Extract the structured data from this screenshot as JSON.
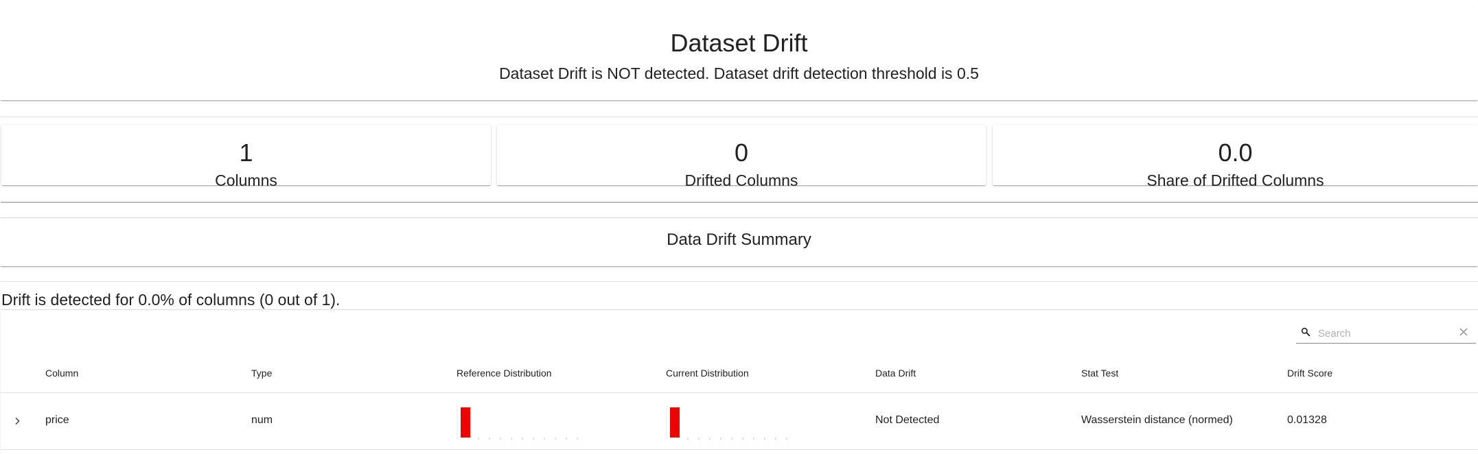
{
  "header": {
    "title": "Dataset Drift",
    "subtitle": "Dataset Drift is NOT detected. Dataset drift detection threshold is 0.5"
  },
  "metrics": [
    {
      "value": "1",
      "label": "Columns"
    },
    {
      "value": "0",
      "label": "Drifted Columns"
    },
    {
      "value": "0.0",
      "label": "Share of Drifted Columns"
    }
  ],
  "summary": {
    "title": "Data Drift Summary",
    "text": "Drift is detected for 0.0% of columns (0 out of 1)."
  },
  "search": {
    "placeholder": "Search",
    "icon": "search-icon",
    "clear_icon": "close-icon"
  },
  "table": {
    "headers": [
      "Column",
      "Type",
      "Reference Distribution",
      "Current Distribution",
      "Data Drift",
      "Stat Test",
      "Drift Score"
    ],
    "rows": [
      {
        "column": "price",
        "type": "num",
        "data_drift": "Not Detected",
        "stat_test": "Wasserstein distance (normed)",
        "drift_score": "0.01328",
        "expand_icon": "chevron-right-icon"
      }
    ]
  },
  "colors": {
    "histogram": "#ed0400",
    "divider": "#e0e0e0",
    "text": "#212121"
  }
}
